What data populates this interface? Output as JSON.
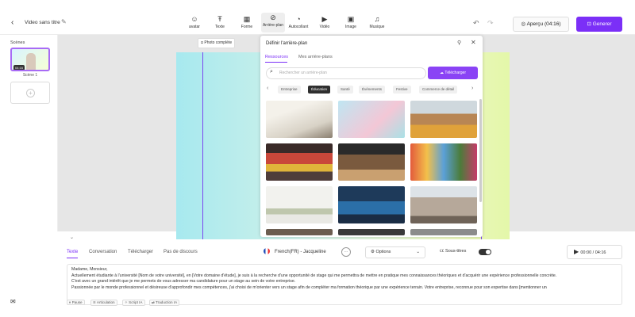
{
  "header": {
    "title": "Video sans titre",
    "preview_label": "Aperçu (04:16)",
    "generate_label": "Generer",
    "tools": [
      {
        "label": "avatar",
        "icon": "avatar-icon"
      },
      {
        "label": "Texte",
        "icon": "text-icon"
      },
      {
        "label": "Forme",
        "icon": "shapes-icon"
      },
      {
        "label": "Arrière-plan",
        "icon": "background-icon"
      },
      {
        "label": "Autocollant",
        "icon": "sticker-icon"
      },
      {
        "label": "Vidéo",
        "icon": "video-icon"
      },
      {
        "label": "Image",
        "icon": "image-icon"
      },
      {
        "label": "Musique",
        "icon": "music-icon"
      }
    ]
  },
  "sidebar": {
    "scenes_label": "Scènes",
    "scene1_label": "Scène 1",
    "scene1_duration": "04:16"
  },
  "canvas": {
    "photo_label": "Photo complète"
  },
  "modal": {
    "title": "Définir l'arrière-plan",
    "tabs": [
      "Ressources",
      "Mes arrière-plans"
    ],
    "search_placeholder": "Rechercher un arrière-plan",
    "upload_label": "Télécharger",
    "categories": [
      "Entreprise",
      "Éducation",
      "Santé",
      "Événements",
      "Festive",
      "Commerce de détail"
    ],
    "active_category": "Éducation"
  },
  "bottom": {
    "tabs": [
      "Texte",
      "Conversation",
      "Télécharger",
      "Pas de discours"
    ],
    "voice": "French(FR) - Jacqueline",
    "options_label": "Options",
    "subtitles_label": "Sous-titres",
    "time": "00:00 / 04:16",
    "script_lines": [
      "Madame, Monsieur,",
      "Actuellement étudiante à l'université [Nom de votre université], en [Votre domaine d'étude], je suis à la recherche d'une opportunité de stage qui me permettra de mettre en pratique mes connaissances théoriques et d'acquérir une expérience professionnelle concrète.",
      "C'est avec un grand intérêt que je me permets de vous adresser ma candidature pour un stage au sein de votre entreprise.",
      "Passionnée par le monde professionnel et désireuse d'approfondir mes compétences, j'ai choisi de m'orienter vers un stage afin de compléter ma formation théorique par une expérience terrain. Votre entreprise, reconnue pour son expertise dans [mentionner un"
    ],
    "pills": [
      "Pause",
      "Articulation",
      "Script IA",
      "Traduction IA"
    ]
  },
  "colors": {
    "accent": "#7b2ff7"
  }
}
